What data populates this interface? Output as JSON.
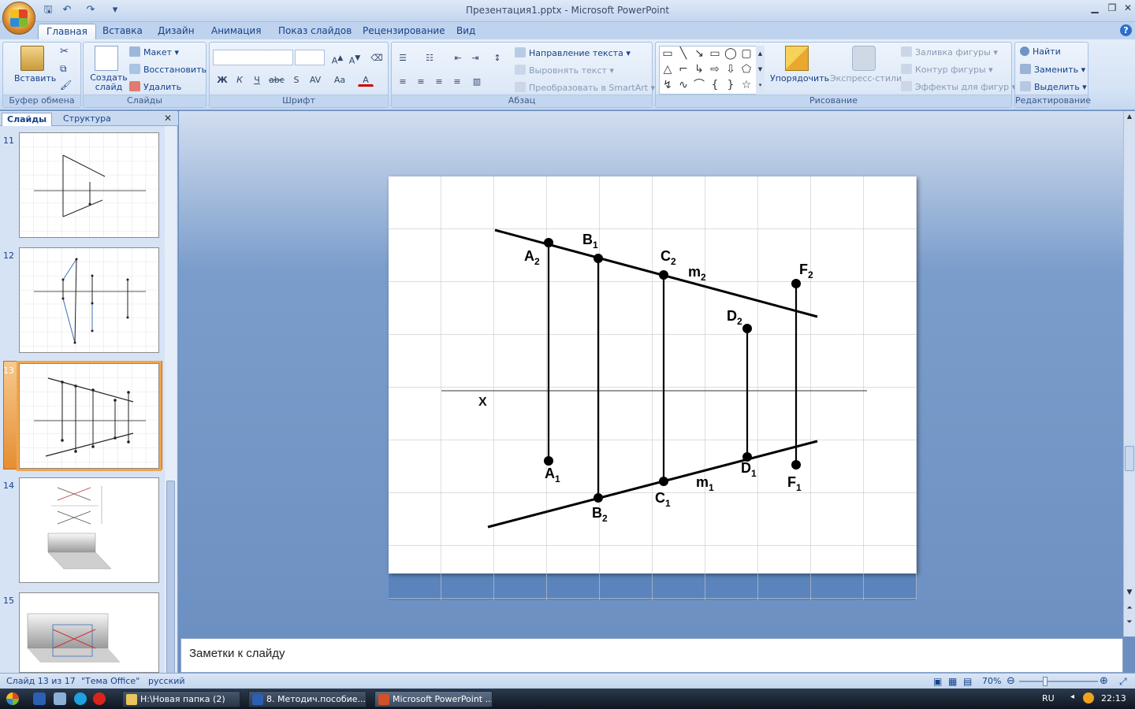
{
  "window": {
    "title": "Презентация1.pptx - Microsoft PowerPoint"
  },
  "ribbon": {
    "tabs": [
      "Главная",
      "Вставка",
      "Дизайн",
      "Анимация",
      "Показ слайдов",
      "Рецензирование",
      "Вид"
    ],
    "clipboard": {
      "paste": "Вставить",
      "group": "Буфер обмена"
    },
    "slides": {
      "new_slide": "Создать слайд",
      "layout": "Макет",
      "reset": "Восстановить",
      "delete": "Удалить",
      "group": "Слайды"
    },
    "font": {
      "group": "Шрифт"
    },
    "paragraph": {
      "text_direction": "Направление текста",
      "align_text": "Выровнять текст",
      "smartart": "Преобразовать в SmartArt",
      "group": "Абзац"
    },
    "drawing": {
      "arrange": "Упорядочить",
      "quick_styles": "Экспресс-стили",
      "shape_fill": "Заливка фигуры",
      "shape_outline": "Контур фигуры",
      "shape_effects": "Эффекты для фигур",
      "group": "Рисование"
    },
    "editing": {
      "find": "Найти",
      "replace": "Заменить",
      "select": "Выделить",
      "group": "Редактирование"
    }
  },
  "leftpane": {
    "tabs": [
      "Слайды",
      "Структура"
    ],
    "slide_numbers": [
      "11",
      "12",
      "13",
      "14",
      "15"
    ],
    "selected": "13"
  },
  "slide": {
    "axis_label": "X",
    "line_top_label": "m",
    "line_top_sub": "2",
    "line_bottom_label": "m",
    "line_bottom_sub": "1",
    "points_top": [
      {
        "name": "A",
        "sub": "2"
      },
      {
        "name": "B",
        "sub": "1"
      },
      {
        "name": "C",
        "sub": "2"
      },
      {
        "name": "D",
        "sub": "2"
      },
      {
        "name": "F",
        "sub": "2"
      }
    ],
    "points_bottom": [
      {
        "name": "A",
        "sub": "1"
      },
      {
        "name": "B",
        "sub": "2"
      },
      {
        "name": "C",
        "sub": "1"
      },
      {
        "name": "D",
        "sub": "1"
      },
      {
        "name": "F",
        "sub": "1"
      }
    ]
  },
  "notes": {
    "placeholder": "Заметки к слайду"
  },
  "status": {
    "slide": "Слайд 13 из 17",
    "theme": "\"Тема Office\"",
    "language": "русский",
    "zoom": "70%"
  },
  "taskbar": {
    "items": [
      "H:\\Новая папка (2)",
      "8. Методич.пособие...",
      "Microsoft PowerPoint ..."
    ],
    "lang": "RU",
    "time": "22:13"
  }
}
